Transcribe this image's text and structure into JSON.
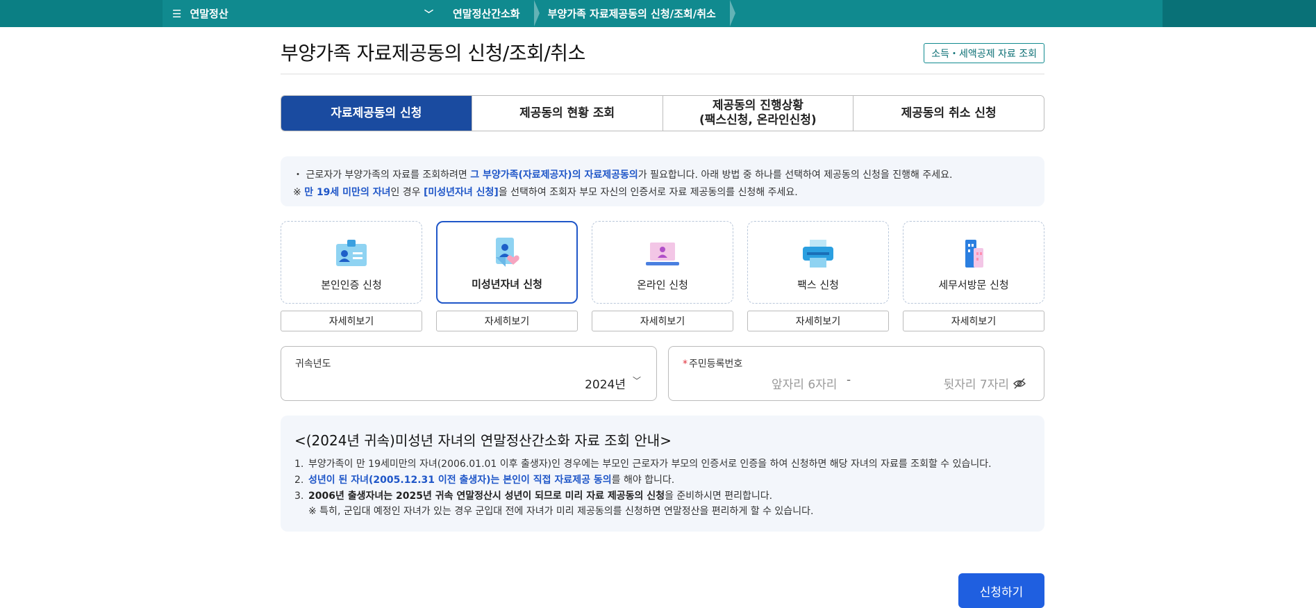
{
  "topbar": {
    "menu_label": "연말정산",
    "breadcrumbs": [
      "연말정산간소화",
      "부양가족 자료제공동의 신청/조회/취소"
    ]
  },
  "page": {
    "title": "부양가족 자료제공동의 신청/조회/취소",
    "lookup_button": "소득・세액공제 자료 조회"
  },
  "tabs": [
    {
      "label": "자료제공동의 신청",
      "active": true
    },
    {
      "label": "제공동의 현황 조회",
      "active": false
    },
    {
      "label": "제공동의 진행상황\n(팩스신청, 온라인신청)",
      "active": false
    },
    {
      "label": "제공동의 취소 신청",
      "active": false
    }
  ],
  "notice": {
    "line1_a": "・ 근로자가 부양가족의 자료를 조회하려면 ",
    "line1_hl": "그 부양가족(자료제공자)의 자료제공동의",
    "line1_b": "가 필요합니다. 아래 방법 중 하나를 선택하여 제공동의 신청을 진행해 주세요.",
    "line2_a": "※ ",
    "line2_hl1": "만 19세 미만의 자녀",
    "line2_b": "인 경우 ",
    "line2_hl2": "[미성년자녀 신청]",
    "line2_c": "을 선택하여 조회자 부모 자신의 인증서로 자료 제공동의를 신청해 주세요."
  },
  "methods": [
    {
      "label": "본인인증 신청",
      "icon": "id-card-icon",
      "selected": false,
      "detail": "자세히보기"
    },
    {
      "label": "미성년자녀 신청",
      "icon": "child-heart-icon",
      "selected": true,
      "detail": "자세히보기"
    },
    {
      "label": "온라인 신청",
      "icon": "laptop-icon",
      "selected": false,
      "detail": "자세히보기"
    },
    {
      "label": "팩스 신청",
      "icon": "fax-printer-icon",
      "selected": false,
      "detail": "자세히보기"
    },
    {
      "label": "세무서방문 신청",
      "icon": "building-icon",
      "selected": false,
      "detail": "자세히보기"
    }
  ],
  "form": {
    "year_label": "귀속년도",
    "year_value": "2024년",
    "rrn_label": "주민등록번호",
    "rrn_required_mark": "*",
    "rrn_front_placeholder": "앞자리 6자리",
    "rrn_dash": "-",
    "rrn_back_placeholder": "뒷자리 7자리"
  },
  "guide": {
    "title": "<(2024년 귀속)미성년 자녀의 연말정산간소화 자료 조회 안내>",
    "item1": "부양가족이 만 19세미만의 자녀(2006.01.01 이후 출생자)인 경우에는 부모인 근로자가 부모의 인증서로 인증을 하여 신청하면 해당 자녀의 자료를 조회할 수 있습니다.",
    "item2_hl": "성년이 된 자녀(2005.12.31 이전 출생자)는 본인이 직접 자료제공 동의",
    "item2_rest": "를 해야 합니다.",
    "item3_bold": "2006년 출생자녀는 2025년 귀속 연말정산시 성년이 되므로 미리 자료 제공동의 신청",
    "item3_rest": "을 준비하시면 편리합니다.",
    "item3_sub": "※ 특히, 군입대 예정인 자녀가 있는 경우 군입대 전에 자녀가 미리 제공동의를 신청하면 연말정산을 편리하게 할 수 있습니다."
  },
  "submit_label": "신청하기",
  "colors": {
    "teal": "#108a8f",
    "primary": "#1a4ba0",
    "accent": "#1f56c8",
    "button": "#1f5fe0"
  }
}
